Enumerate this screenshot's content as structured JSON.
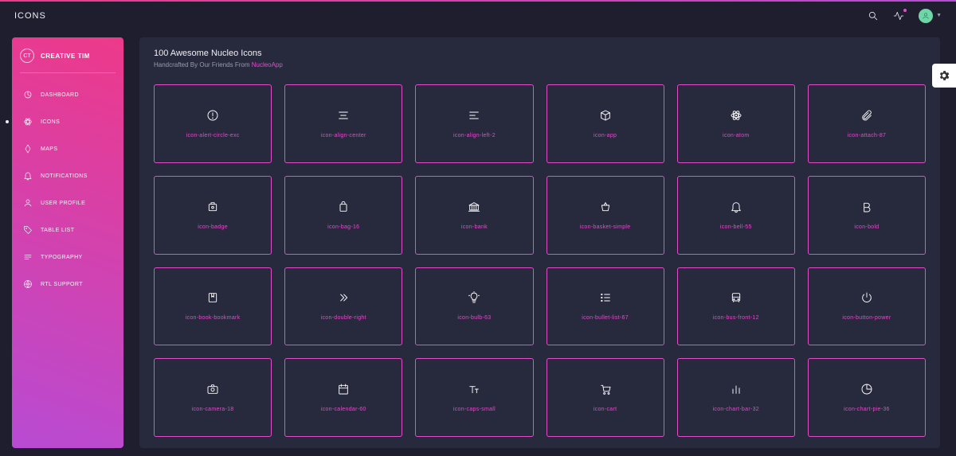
{
  "header": {
    "title": "ICONS"
  },
  "brand": {
    "short": "CT",
    "name": "CREATIVE TIM"
  },
  "sidebar": {
    "items": [
      {
        "label": "DASHBOARD"
      },
      {
        "label": "ICONS"
      },
      {
        "label": "MAPS"
      },
      {
        "label": "NOTIFICATIONS"
      },
      {
        "label": "USER PROFILE"
      },
      {
        "label": "TABLE LIST"
      },
      {
        "label": "TYPOGRAPHY"
      },
      {
        "label": "RTL SUPPORT"
      }
    ]
  },
  "page": {
    "title": "100 Awesome Nucleo Icons",
    "subtitle_prefix": "Handcrafted By Our Friends From ",
    "subtitle_link": "NucleoApp"
  },
  "icons": [
    {
      "name": "icon-alert-circle-exc"
    },
    {
      "name": "icon-align-center"
    },
    {
      "name": "icon-align-left-2"
    },
    {
      "name": "icon-app"
    },
    {
      "name": "icon-atom"
    },
    {
      "name": "icon-attach-87"
    },
    {
      "name": "icon-badge"
    },
    {
      "name": "icon-bag-16"
    },
    {
      "name": "icon-bank"
    },
    {
      "name": "icon-basket-simple"
    },
    {
      "name": "icon-bell-55"
    },
    {
      "name": "icon-bold"
    },
    {
      "name": "icon-book-bookmark"
    },
    {
      "name": "icon-double-right"
    },
    {
      "name": "icon-bulb-63"
    },
    {
      "name": "icon-bullet-list-67"
    },
    {
      "name": "icon-bus-front-12"
    },
    {
      "name": "icon-button-power"
    },
    {
      "name": "icon-camera-18"
    },
    {
      "name": "icon-calendar-60"
    },
    {
      "name": "icon-caps-small"
    },
    {
      "name": "icon-cart"
    },
    {
      "name": "icon-chart-bar-32"
    },
    {
      "name": "icon-chart-pie-36"
    }
  ]
}
